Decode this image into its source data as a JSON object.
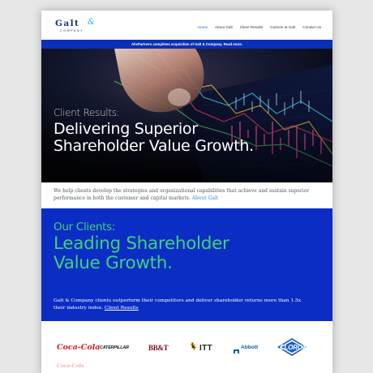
{
  "header": {
    "logo_word": "Galt",
    "logo_amp": "&",
    "logo_sub": "COMPANY",
    "nav": [
      {
        "label": "Home",
        "active": true
      },
      {
        "label": "About Galt",
        "active": false
      },
      {
        "label": "Client Results",
        "active": false
      },
      {
        "label": "Careers at Galt",
        "active": false
      },
      {
        "label": "Contact Us",
        "active": false
      }
    ]
  },
  "announcement": "AlixPartners completes acquisition of Galt & Company. Read more.",
  "hero": {
    "kicker": "Client Results:",
    "title": "Delivering Superior Shareholder Value Growth."
  },
  "intro": {
    "text": "We help clients develop the strategies and organizational capabilities that achieve and sustain superior performance in both the customer and capital markets.",
    "link": "About Galt"
  },
  "clients": {
    "kicker": "Our Clients:",
    "title": "Leading Shareholder Value Growth.",
    "text": "Galt & Company clients outperform their competitors and deliver shareholder returns more than 1.5x their industry index.",
    "link": "Client Results"
  },
  "logos": {
    "coke": "Coca-Cola",
    "caterpillar": "CATERPILLAR",
    "bbt": "BB&T",
    "itt": "ITT",
    "abbott": "Abbott",
    "clorox": "CLOROX"
  },
  "colors": {
    "brand_blue": "#0b2dc4",
    "accent_green": "#3fd27a",
    "link_blue": "#2a8fd8",
    "logo_navy": "#1c2f8a"
  }
}
